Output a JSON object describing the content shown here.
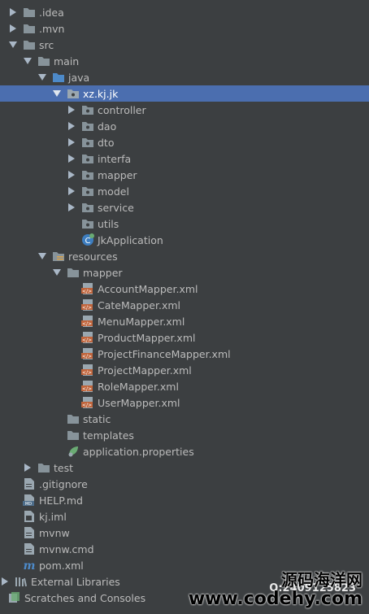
{
  "project_tree": {
    "items": [
      {
        "label": ".idea",
        "icon": "folder-icon",
        "expanded": false
      },
      {
        "label": ".mvn",
        "icon": "folder-icon",
        "expanded": false
      },
      {
        "label": "src",
        "icon": "folder-icon",
        "expanded": true
      },
      {
        "label": "main",
        "icon": "folder-icon",
        "expanded": true
      },
      {
        "label": "java",
        "icon": "source-folder-icon",
        "expanded": true
      },
      {
        "label": "xz.kj.jk",
        "icon": "package-icon",
        "expanded": true,
        "selected": true
      },
      {
        "label": "controller",
        "icon": "package-icon",
        "expanded": false
      },
      {
        "label": "dao",
        "icon": "package-icon",
        "expanded": false
      },
      {
        "label": "dto",
        "icon": "package-icon",
        "expanded": false
      },
      {
        "label": "interfa",
        "icon": "package-icon",
        "expanded": false
      },
      {
        "label": "mapper",
        "icon": "package-icon",
        "expanded": false
      },
      {
        "label": "model",
        "icon": "package-icon",
        "expanded": false
      },
      {
        "label": "service",
        "icon": "package-icon",
        "expanded": false
      },
      {
        "label": "utils",
        "icon": "package-icon"
      },
      {
        "label": "JkApplication",
        "icon": "spring-boot-class-icon"
      },
      {
        "label": "resources",
        "icon": "resources-folder-icon",
        "expanded": true
      },
      {
        "label": "mapper",
        "icon": "folder-icon",
        "expanded": true
      },
      {
        "label": "AccountMapper.xml",
        "icon": "xml-file-icon"
      },
      {
        "label": "CateMapper.xml",
        "icon": "xml-file-icon"
      },
      {
        "label": "MenuMapper.xml",
        "icon": "xml-file-icon"
      },
      {
        "label": "ProductMapper.xml",
        "icon": "xml-file-icon"
      },
      {
        "label": "ProjectFinanceMapper.xml",
        "icon": "xml-file-icon"
      },
      {
        "label": "ProjectMapper.xml",
        "icon": "xml-file-icon"
      },
      {
        "label": "RoleMapper.xml",
        "icon": "xml-file-icon"
      },
      {
        "label": "UserMapper.xml",
        "icon": "xml-file-icon"
      },
      {
        "label": "static",
        "icon": "folder-icon"
      },
      {
        "label": "templates",
        "icon": "folder-icon"
      },
      {
        "label": "application.properties",
        "icon": "spring-properties-icon"
      },
      {
        "label": "test",
        "icon": "folder-icon",
        "expanded": false
      },
      {
        "label": ".gitignore",
        "icon": "text-file-icon"
      },
      {
        "label": "HELP.md",
        "icon": "markdown-file-icon"
      },
      {
        "label": "kj.iml",
        "icon": "iml-file-icon"
      },
      {
        "label": "mvnw",
        "icon": "text-file-icon"
      },
      {
        "label": "mvnw.cmd",
        "icon": "text-file-icon"
      },
      {
        "label": "pom.xml",
        "icon": "maven-icon"
      },
      {
        "label": "External Libraries",
        "icon": "libraries-icon",
        "expanded": false
      },
      {
        "label": "Scratches and Consoles",
        "icon": "scratches-icon"
      }
    ]
  },
  "watermark": {
    "cn": "源码海洋网",
    "en": "www.codehy.com",
    "qq": "Q:2409125823"
  },
  "colors": {
    "background": "#3c3f41",
    "selection": "#4b6eaf",
    "text": "#bbbbbb",
    "folder": "#87939a",
    "source_folder": "#4d8ac9",
    "xml_icon": "#c0653c",
    "spring_green": "#6aab73"
  }
}
